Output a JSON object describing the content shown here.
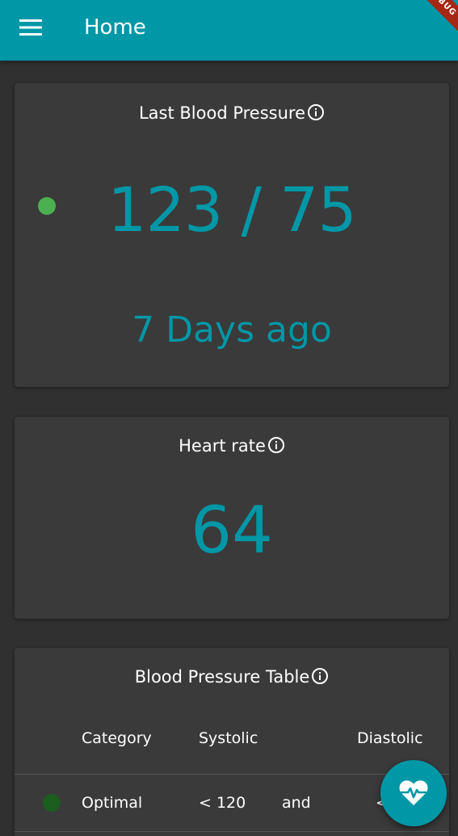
{
  "appbar": {
    "title": "Home",
    "menu_icon": "menu-icon",
    "debug_banner": "DEBUG",
    "color": "#0097a7"
  },
  "blood_pressure": {
    "title": "Last Blood Pressure",
    "info_icon": "info-icon",
    "value": "123 / 75",
    "time_ago": "7 Days ago",
    "status_color": "#4caf50"
  },
  "heart_rate": {
    "title": "Heart rate",
    "info_icon": "info-icon",
    "value": "64"
  },
  "bp_table": {
    "title": "Blood Pressure Table",
    "info_icon": "info-icon",
    "headers": {
      "category": "Category",
      "systolic": "Systolic",
      "diastolic": "Diastolic"
    },
    "rows": [
      {
        "color": "#1b5e20",
        "category": "Optimal",
        "systolic": "< 120",
        "conjunction": "and",
        "diastolic": "< 80"
      }
    ]
  },
  "fab": {
    "icon": "heart-pulse-icon"
  }
}
